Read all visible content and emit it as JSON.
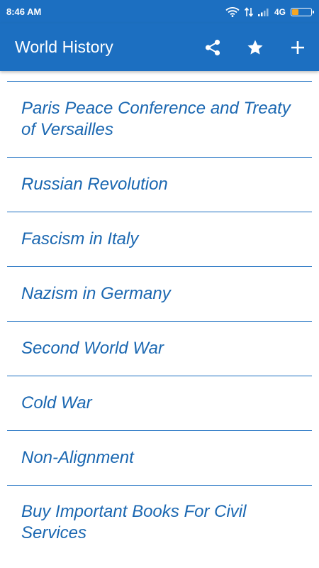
{
  "status_bar": {
    "time": "8:46 AM",
    "network": "4G"
  },
  "app_bar": {
    "title": "World History",
    "actions": [
      {
        "icon": "share-icon"
      },
      {
        "icon": "star-icon"
      },
      {
        "icon": "plus-icon"
      }
    ]
  },
  "topics": [
    "Paris Peace Conference and Treaty of Versailles",
    "Russian Revolution",
    "Fascism in Italy",
    "Nazism in Germany",
    "Second World War",
    "Cold War",
    "Non-Alignment",
    "Buy Important Books For Civil Services"
  ],
  "colors": {
    "primary": "#1c6fc1",
    "topic_text": "#1a67b1",
    "battery": "#f5a623"
  }
}
